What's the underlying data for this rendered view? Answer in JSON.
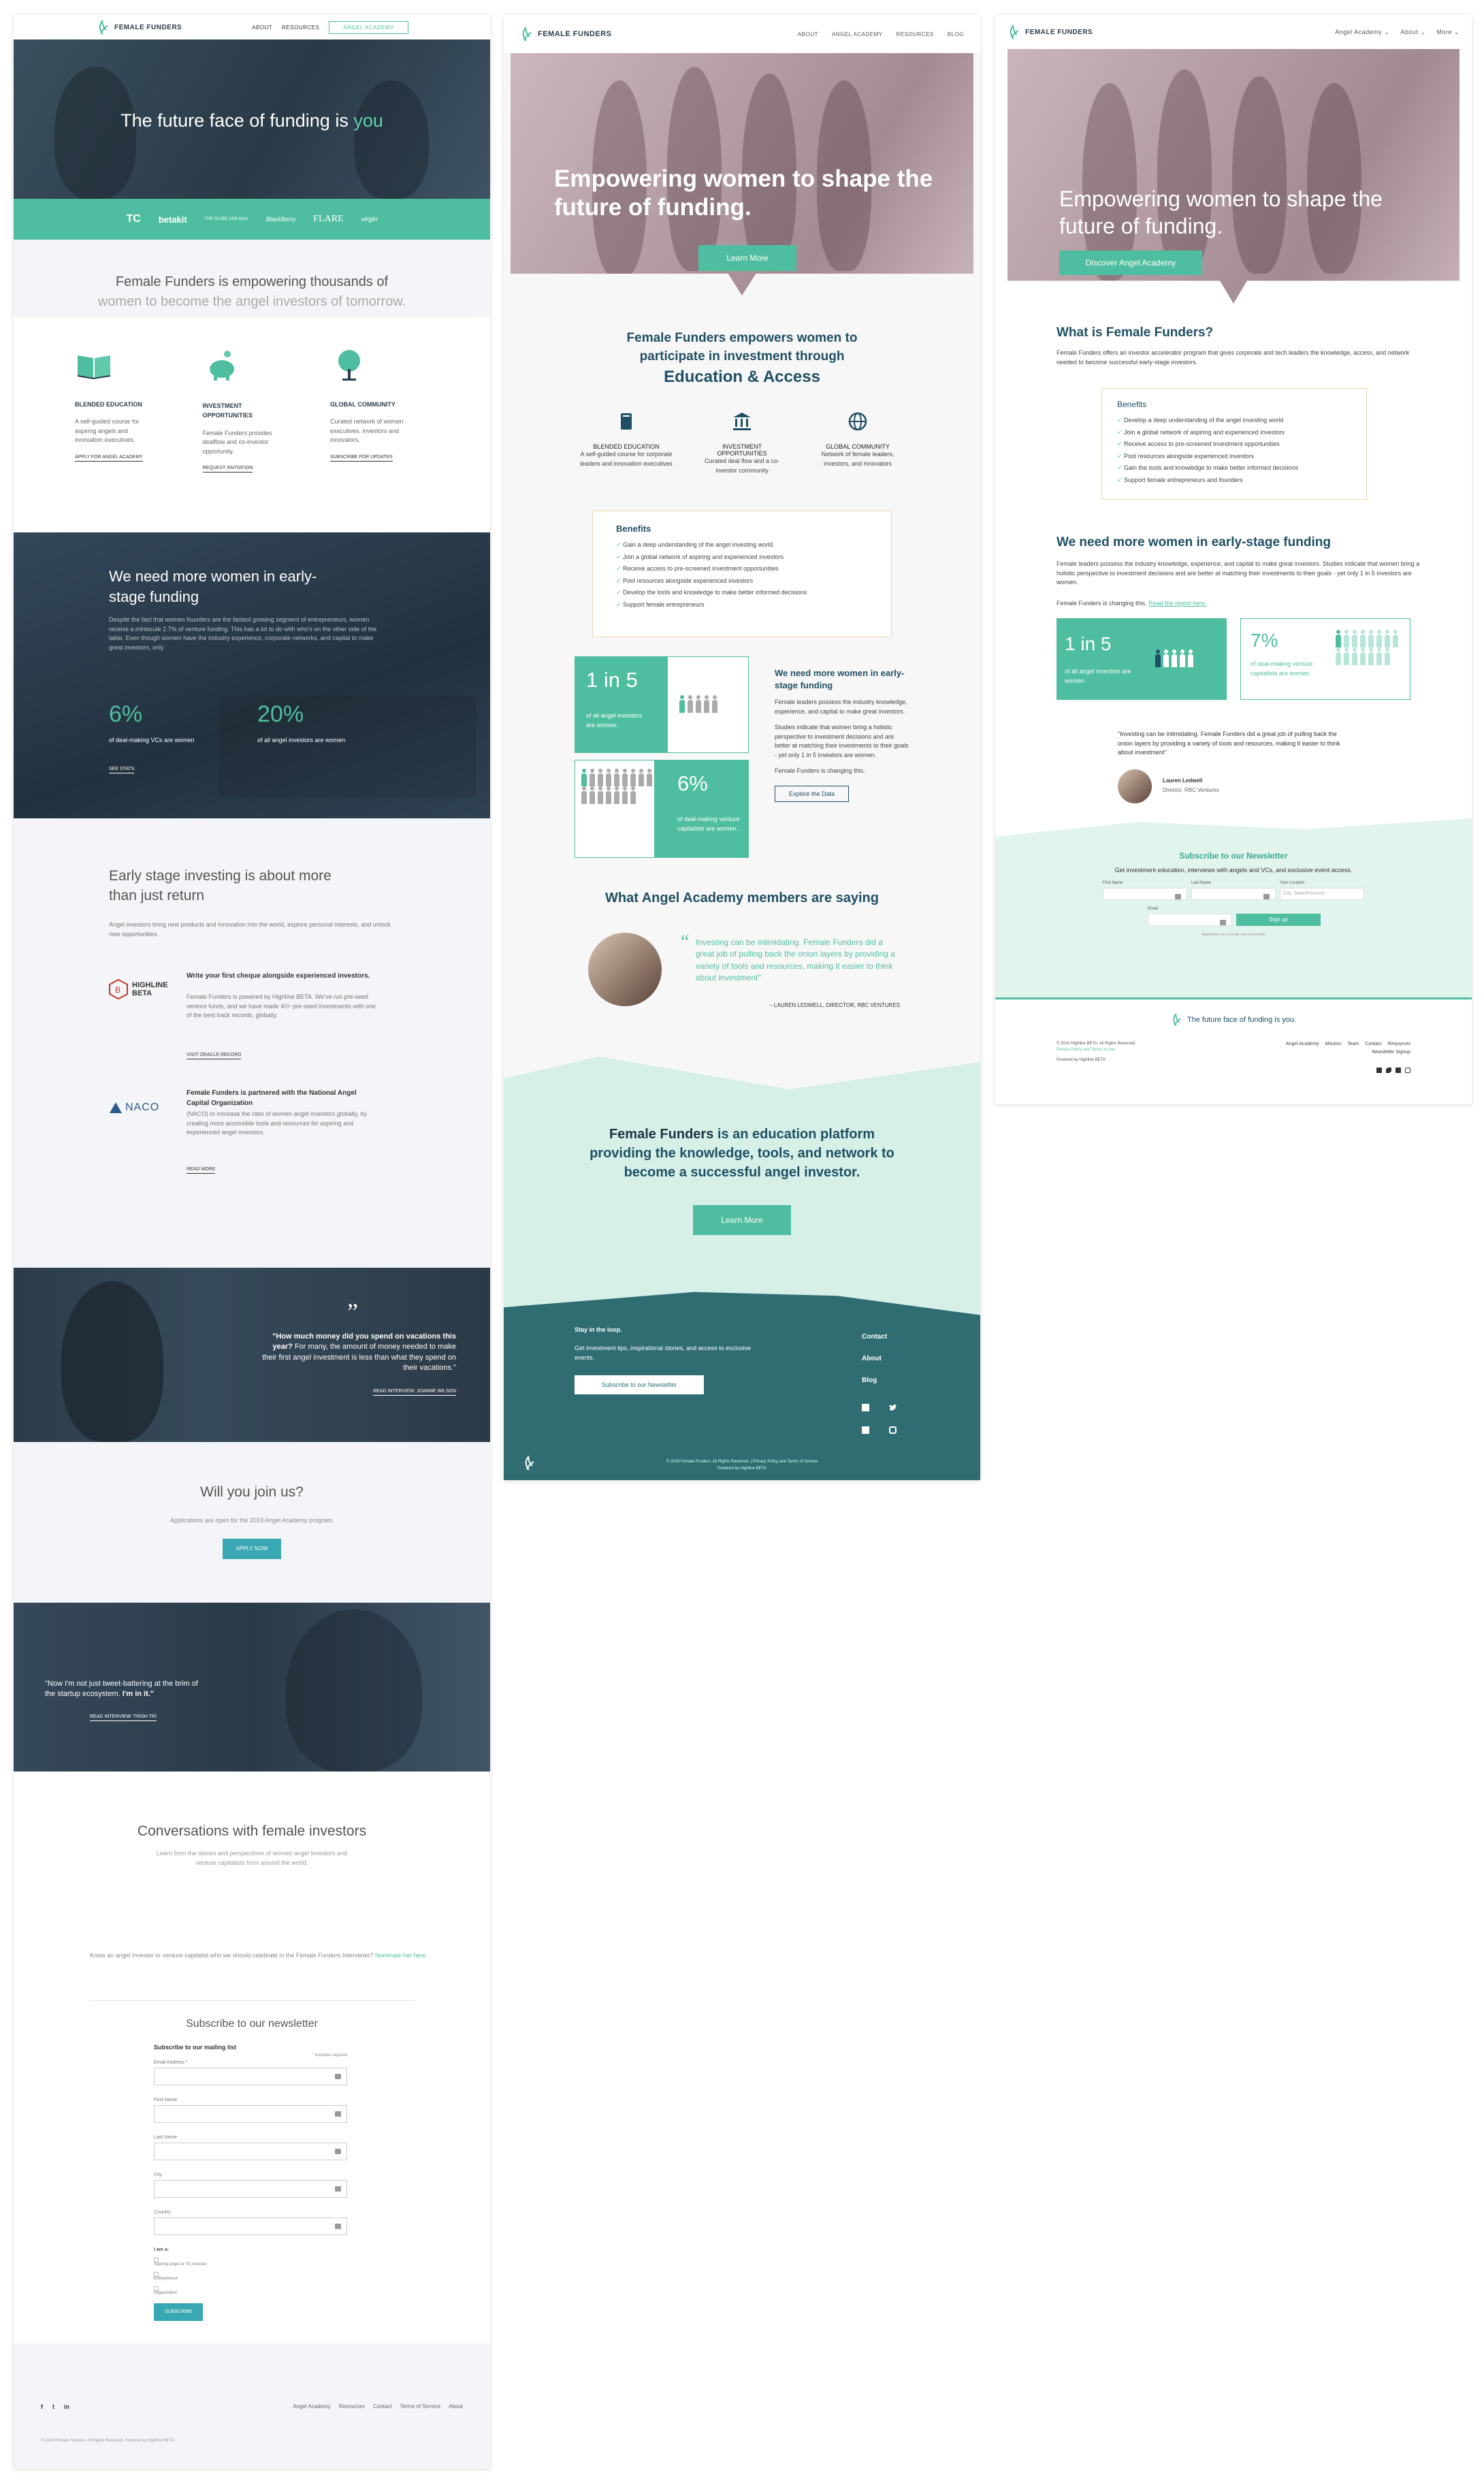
{
  "brand": {
    "name": "FEMALE FUNDERS",
    "teal": "#4fbea0",
    "dark_teal": "#2f6d73",
    "navy": "#2b3c4a"
  },
  "p1": {
    "nav": {
      "about": "ABOUT",
      "resources": "RESOURCES",
      "angel_academy": "ANGEL ACADEMY"
    },
    "hero": {
      "title_pre": "The future face of funding is ",
      "title_em": "you"
    },
    "press": [
      "TC",
      "betakit",
      "THE GLOBE AND MAIL",
      "BlackBerry",
      "FLARE",
      "virgin"
    ],
    "intro": {
      "line1": "Female Funders is empowering thousands of",
      "line2": "women to become the angel investors of tomorrow."
    },
    "features": [
      {
        "title": "BLENDED EDUCATION",
        "text": "A self-guided course for aspiring angels and innovation executives.",
        "link": "APPLY FOR ANGEL ACADEMY",
        "icon": "book-icon"
      },
      {
        "title": "INVESTMENT OPPORTUNITIES",
        "text": "Female Funders provides dealflow and co-investor opportunity.",
        "link": "REQUEST INVITATION",
        "icon": "piggy-bank-icon"
      },
      {
        "title": "GLOBAL COMMUNITY",
        "text": "Curated network of women executives, investors and innovators.",
        "link": "SUBSCRIBE FOR UPDATES",
        "icon": "tree-icon"
      }
    ],
    "need": {
      "title": "We need more women in early-stage funding",
      "text": "Despite the fact that women founders are the fastest growing segment of entrepreneurs, women receive a miniscule 2.7% of venture funding. This has a lot to do with who's on the other side of the table. Even though women have the industry experience, corporate networks, and capital to make great investors, only",
      "text_em": "only",
      "stat1_value": "6%",
      "stat1_label": "of deal-making VCs are women",
      "stat2_value": "20%",
      "stat2_label": "of all angel investors are women",
      "link": "SEE STATS"
    },
    "early": {
      "title": "Early stage investing is about more than just return",
      "text": "Angel investors bring new products and innovation into the world, explore personal interests, and unlock new opportunities.",
      "beta_logo": "HIGHLINE BETA",
      "beta_title": "Write your first cheque alongside experienced investors.",
      "beta_text": "Female Funders is powered by Highline BETA. We've run pre-seed venture funds, and we have made 40+ pre-seed investments with one of the best track records, globally.",
      "beta_link": "VISIT ORACLE RECORD",
      "naco_logo": "NACO",
      "naco_title": "Female Funders is partnered with the National Angel Capital Organization",
      "naco_text": "(NACO) to increase the ratio of women angel investors globally, by creating more accessible tools and resources for aspiring and experienced angel investors.",
      "naco_link": "READ MORE"
    },
    "quote1": {
      "text_b": "\"How much money did you spend on vacations this year?",
      "text": " For many, the amount of money needed to make their first angel investment is less than what they spend on their vacations.\"",
      "link": "READ INTERVIEW: JOANNE WILSON"
    },
    "join": {
      "title": "Will you join us?",
      "text": "Applications are open for the 2019 Angel Academy program.",
      "button": "APPLY NOW"
    },
    "quote2": {
      "text": "\"Now I'm not just tweet-battering at the brim of the startup ecosystem. ",
      "text_b": "I'm in it.\"",
      "link": "READ INTERVIEW: TRISH TRI"
    },
    "conv": {
      "title": "Conversations with female investors",
      "text": "Learn from the stories and perspectives of women angel investors and venture capitalists from around the world."
    },
    "nominate": {
      "text": "Know an angel investor or venture capitalist who we should celebrate in the Female Funders Interviews? ",
      "link": "Nominate her here."
    },
    "newsletter": {
      "title": "Subscribe to our newsletter",
      "form_title": "Subscribe to our mailing list",
      "required": "* indicates required",
      "fields": [
        "Email Address *",
        "First Name",
        "Last Name",
        "City",
        "Country"
      ],
      "checks_label": "I am a:",
      "checks": [
        "Aspiring angel or VC investor",
        "Entrepreneur",
        "Organization"
      ],
      "button": "SUBSCRIBE"
    },
    "footer": {
      "social": [
        "f",
        "t",
        "in"
      ],
      "links": [
        "Angel Academy",
        "Resources",
        "Contact",
        "Terms of Service",
        "About"
      ],
      "copyright": "© 2019 Female Funders. All Rights Reserved. Powered by Highline BETA"
    }
  },
  "p2": {
    "nav": {
      "about": "ABOUT",
      "angel_academy": "ANGEL ACADEMY",
      "resources": "RESOURCES",
      "blog": "BLOG"
    },
    "hero": {
      "title": "Empowering women to shape the future of funding.",
      "button": "Learn More"
    },
    "intro": {
      "line": "Female Funders empowers women to participate in investment through",
      "em": "Education & Access"
    },
    "features": [
      {
        "title": "BLENDED EDUCATION",
        "text": "A self-guided course for corporate leaders and innovation executives",
        "icon": "book-icon"
      },
      {
        "title": "INVESTMENT OPPORTUNITIES",
        "text": "Curated deal flow and a co-investor community",
        "icon": "bank-icon"
      },
      {
        "title": "GLOBAL COMMUNITY",
        "text": "Network of female leaders, investors, and innovators",
        "icon": "globe-icon"
      }
    ],
    "benefits": {
      "title": "Benefits",
      "items": [
        "Gain a deep understanding of the angel investing world",
        "Join a global network of aspiring and experienced investors",
        "Receive access to pre-screened investment opportunities",
        "Pool resources alongside experienced investors",
        "Develop the tools and knowledge to make better informed decisions",
        "Support female entrepreneurs"
      ]
    },
    "stats": {
      "stat1_value": "1 in 5",
      "stat1_label": "of all angel investors are women.",
      "stat2_value": "6%",
      "stat2_label": "of deal-making venture capitalists are women.",
      "title": "We need more women in early-stage funding",
      "text1": "Female leaders possess the industry knowledge, experience, and capital to make great investors.",
      "text2": "Studies indicate that women bring a holistic perspective to investment decisions and are better at matching their investments to their goals - yet only 1 in 5 investors are women.",
      "text3": "Female Funders is changing this.",
      "button": "Explore the Data"
    },
    "members": {
      "title": "What Angel Academy members are saying",
      "quote": "Investing can be intimidating. Female Funders did a great job of pulling back the onion layers by providing a variety of tools and resources, making it easier to think about investment\"",
      "author": "– LAUREN LEDWELL, DIRECTOR, RBC VENTURES"
    },
    "platform": {
      "bold": "Female Funders",
      "text": " is an education platform providing the knowledge, tools, and network to become a successful angel investor.",
      "button": "Learn More"
    },
    "footer": {
      "stay": "Stay in the loop.",
      "text": "Get investment tips, inspirational stories, and access to exclusive events.",
      "button": "Subscribe to our Newsletter",
      "links": [
        "Contact",
        "About",
        "Blog"
      ],
      "copyright": "© 2018 Female Funders. All Rights Reserved. | Privacy Policy and Terms of Service",
      "powered": "Powered by Highline BETA"
    }
  },
  "p3": {
    "nav": {
      "angel_academy": "Angel Academy",
      "about": "About",
      "more": "More"
    },
    "hero": {
      "title": "Empowering women to shape the future of funding.",
      "button": "Discover Angel Academy"
    },
    "what": {
      "title": "What is Female Funders?",
      "text": "Female Funders offers an investor accelerator program that gives corporate and tech leaders the knowledge, access, and network needed to become successful early-stage investors."
    },
    "benefits": {
      "title": "Benefits",
      "items": [
        "Develop a deep understanding of the angel investing world",
        "Join a global network of aspiring and experienced investors",
        "Receive access to pre-screened investment opportunities",
        "Pool resources alongside experienced investors",
        "Gain the tools and knowledge to make better informed decisions",
        "Support female entrepreneurs and founders"
      ]
    },
    "need": {
      "title": "We need more women in early-stage funding",
      "text": "Female leaders possess the industry knowledge, experience, and capital to make great investors. Studies indicate that women bring a holistic perspective to investment decisions and are better at matching their investments to their goals - yet only 1 in 5 investors are women.",
      "changing": "Female Funders is changing this. ",
      "link": "Read the report here.",
      "stat1_value": "1 in 5",
      "stat1_label": "of all angel investors are women",
      "stat2_value": "7%",
      "stat2_label": "of deal-making venture capitalists are women"
    },
    "quote": {
      "text": "\"Investing can be intimidating. Female Funders did a great job of pulling back the onion layers by providing a variety of tools and resources, making it easier to think about investment\"",
      "name": "Lauren Ledwell",
      "role": "Director, RBC Ventures"
    },
    "newsletter": {
      "title": "Subscribe to our Newsletter",
      "text": "Get investment education, interviews with angels and VCs, and exclusive event access.",
      "first": "First Name",
      "last": "Last Name",
      "location": "Your Location",
      "location_ph": "City, State/Province",
      "email": "Email",
      "button": "Sign up",
      "note": "Newsletters are currently sent out monthly"
    },
    "footer": {
      "tagline": "The future face of funding is you.",
      "copyright": "© 2019 Highline BETA. All Rights Reserved.",
      "privacy": "Privacy Policy and Terms of Use",
      "powered": "Powered by Highline BETA",
      "links": [
        "Angel Academy",
        "Mission",
        "Team",
        "Contact",
        "Resources"
      ],
      "signup": "Newsletter Signup"
    }
  }
}
